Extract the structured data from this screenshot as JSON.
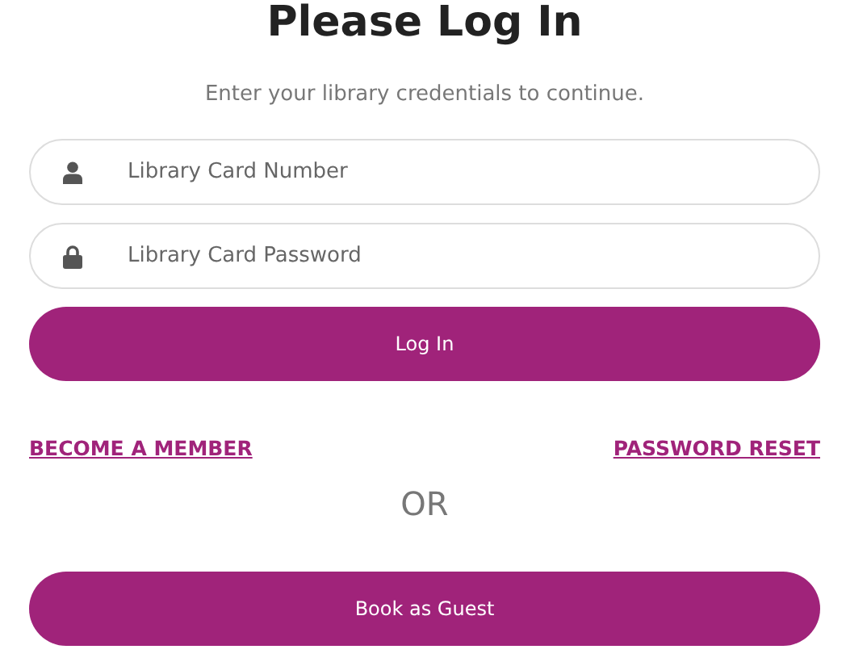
{
  "title": "Please Log In",
  "subtitle": "Enter your library credentials to continue.",
  "fields": [
    {
      "kind": "person",
      "placeholder": "Library Card Number"
    },
    {
      "kind": "lock",
      "placeholder": "Library Card Password"
    }
  ],
  "login_button": "Log In",
  "links": [
    "BECOME A MEMBER",
    "PASSWORD RESET"
  ],
  "separator": "OR",
  "guest_button": "Book as Guest"
}
